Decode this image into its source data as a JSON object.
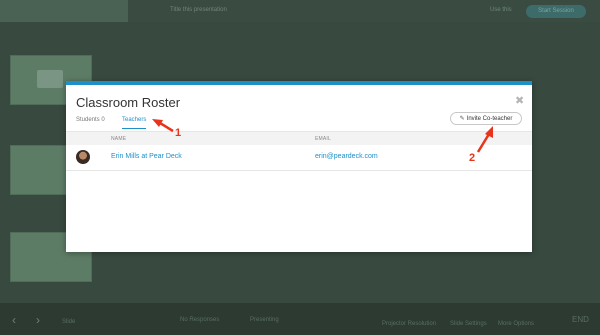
{
  "background": {
    "top_left_text": "Title this presentation",
    "top_right_link": "Use this",
    "top_button": "Start Session",
    "bottom_items": [
      "Slide",
      "No Responses",
      "Presenting",
      "Projector Resolution",
      "Slide Settings",
      "More Options"
    ],
    "bottom_right": "END"
  },
  "modal": {
    "title": "Classroom Roster",
    "tabs": [
      {
        "label": "Students 0",
        "active": false
      },
      {
        "label": "Teachers",
        "active": true
      }
    ],
    "invite_button": "Invite Co-teacher",
    "columns": [
      "NAME",
      "EMAIL"
    ],
    "rows": [
      {
        "name": "Erin Mills at Pear Deck",
        "email": "erin@peardeck.com"
      }
    ],
    "accent_color": "#1e90c9"
  },
  "annotations": {
    "callout_1": "1",
    "callout_2": "2",
    "color": "#e8341c"
  }
}
